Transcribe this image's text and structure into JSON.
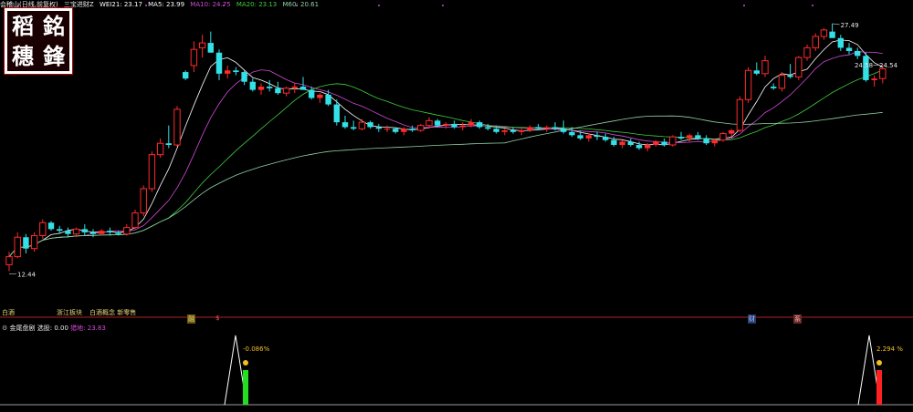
{
  "header": {
    "title": "会稽山(日线,前复权)",
    "indicator_name": "三宝进财Z",
    "wei21": "WEI21: 23.17",
    "ma5": "MA5: 23.99",
    "ma10": "MA10: 24.75",
    "ma20": "MA20: 23.13",
    "m60": "M60: 20.61"
  },
  "colors": {
    "up": "#ff2a2a",
    "down": "#33e0e6",
    "ma5": "#ffffff",
    "ma10": "#d24ad6",
    "ma20": "#3ecf3e",
    "m60": "#8fd2a8",
    "sector": "#e8d27a"
  },
  "seal": {
    "chars": [
      "稻",
      "銘",
      "穗",
      "鋒"
    ]
  },
  "sector_labels": [
    "白酒",
    "浙江板块",
    "白酒概念 新零售"
  ],
  "event_tags": [
    {
      "text": "融",
      "color": "#e8d27a",
      "bg": "#6a5a10"
    },
    {
      "text": "$",
      "color": "#ff5050",
      "bg": "none"
    },
    {
      "text": "财",
      "color": "#a8c8ff",
      "bg": "#2a3a6a"
    },
    {
      "text": "系",
      "color": "#ffb0b0",
      "bg": "#6a2a2a"
    }
  ],
  "indicator_panel": {
    "name": "金尾盘剧",
    "param_label": "选股: 0.00",
    "hunt_label": "猎地: 23.83",
    "signals": [
      {
        "label": "-0.086%",
        "value": -0.086,
        "bar_color": "#22dd22"
      },
      {
        "label": "2.294 %",
        "value": 2.294,
        "bar_color": "#ff2020"
      }
    ]
  },
  "chart_data": {
    "type": "candlestick",
    "title": "会稽山(日线,前复权)",
    "ylim": [
      11.5,
      28.5
    ],
    "annotations": {
      "high": "27.49",
      "low": "12.44",
      "level_a": "24.58",
      "level_b": "24.54"
    },
    "candles": [
      [
        12.6,
        13.4,
        12.2,
        13.1
      ],
      [
        13.1,
        14.6,
        13.0,
        14.3
      ],
      [
        14.3,
        14.5,
        13.3,
        13.6
      ],
      [
        13.6,
        14.6,
        13.4,
        14.4
      ],
      [
        14.4,
        15.4,
        14.2,
        15.2
      ],
      [
        15.2,
        15.3,
        14.7,
        14.8
      ],
      [
        14.8,
        15.0,
        14.5,
        14.7
      ],
      [
        14.7,
        14.9,
        14.3,
        14.5
      ],
      [
        14.5,
        14.9,
        14.3,
        14.8
      ],
      [
        14.8,
        15.1,
        14.4,
        14.6
      ],
      [
        14.6,
        14.8,
        14.3,
        14.5
      ],
      [
        14.5,
        14.8,
        14.4,
        14.7
      ],
      [
        14.7,
        14.9,
        14.4,
        14.6
      ],
      [
        14.6,
        14.7,
        14.4,
        14.5
      ],
      [
        14.5,
        15.1,
        14.4,
        14.9
      ],
      [
        14.9,
        16.0,
        14.8,
        15.8
      ],
      [
        15.8,
        17.5,
        15.6,
        17.3
      ],
      [
        17.3,
        19.6,
        17.1,
        19.4
      ],
      [
        19.4,
        20.4,
        19.2,
        20.1
      ],
      [
        20.1,
        21.2,
        19.8,
        20.0
      ],
      [
        20.0,
        22.4,
        19.9,
        22.2
      ],
      [
        24.5,
        24.6,
        24.0,
        24.1
      ],
      [
        24.9,
        26.4,
        24.5,
        25.9
      ],
      [
        26.0,
        26.8,
        25.4,
        26.3
      ],
      [
        26.3,
        27.0,
        25.7,
        25.7
      ],
      [
        25.7,
        25.9,
        24.0,
        24.4
      ],
      [
        24.4,
        24.9,
        24.1,
        24.6
      ],
      [
        24.6,
        24.8,
        24.3,
        24.5
      ],
      [
        24.5,
        24.6,
        23.7,
        23.9
      ],
      [
        23.9,
        24.1,
        23.3,
        23.4
      ],
      [
        23.4,
        23.8,
        23.1,
        23.6
      ],
      [
        23.6,
        24.0,
        23.3,
        23.5
      ],
      [
        23.5,
        23.9,
        23.1,
        23.2
      ],
      [
        23.2,
        23.6,
        23.0,
        23.5
      ],
      [
        23.5,
        23.8,
        23.2,
        23.6
      ],
      [
        23.6,
        24.2,
        23.4,
        23.4
      ],
      [
        23.4,
        23.6,
        22.8,
        22.9
      ],
      [
        22.9,
        23.2,
        22.6,
        23.1
      ],
      [
        23.1,
        23.4,
        22.4,
        22.5
      ],
      [
        22.5,
        22.8,
        21.2,
        21.4
      ],
      [
        21.4,
        21.8,
        21.0,
        21.1
      ],
      [
        21.1,
        21.5,
        20.9,
        21.0
      ],
      [
        21.0,
        21.6,
        20.9,
        21.4
      ],
      [
        21.4,
        21.5,
        21.0,
        21.1
      ],
      [
        21.1,
        21.3,
        20.8,
        21.0
      ],
      [
        21.0,
        21.2,
        20.8,
        21.0
      ],
      [
        21.0,
        21.1,
        20.7,
        20.8
      ],
      [
        20.8,
        21.1,
        20.6,
        21.0
      ],
      [
        21.0,
        21.2,
        20.8,
        20.9
      ],
      [
        20.9,
        21.3,
        20.8,
        21.2
      ],
      [
        21.2,
        21.7,
        21.0,
        21.5
      ],
      [
        21.5,
        21.6,
        21.1,
        21.2
      ],
      [
        21.2,
        21.4,
        21.0,
        21.3
      ],
      [
        21.3,
        21.5,
        21.0,
        21.1
      ],
      [
        21.1,
        21.4,
        20.9,
        21.2
      ],
      [
        21.2,
        21.6,
        21.1,
        21.4
      ],
      [
        21.4,
        21.5,
        21.0,
        21.1
      ],
      [
        21.1,
        21.3,
        20.9,
        21.0
      ],
      [
        21.0,
        21.2,
        20.7,
        20.8
      ],
      [
        20.8,
        21.0,
        20.6,
        20.9
      ],
      [
        20.9,
        21.1,
        20.7,
        20.8
      ],
      [
        20.8,
        21.0,
        20.6,
        20.9
      ],
      [
        20.9,
        21.2,
        20.8,
        21.1
      ],
      [
        21.1,
        21.3,
        20.9,
        21.0
      ],
      [
        21.0,
        21.2,
        20.8,
        21.1
      ],
      [
        21.1,
        21.4,
        20.9,
        21.0
      ],
      [
        21.0,
        21.5,
        20.7,
        20.8
      ],
      [
        20.8,
        21.1,
        20.5,
        20.6
      ],
      [
        20.6,
        20.9,
        20.3,
        20.4
      ],
      [
        20.4,
        20.7,
        20.2,
        20.6
      ],
      [
        20.6,
        20.8,
        20.3,
        20.5
      ],
      [
        20.5,
        20.7,
        20.2,
        20.3
      ],
      [
        20.3,
        20.5,
        19.9,
        20.0
      ],
      [
        20.0,
        20.3,
        19.8,
        20.2
      ],
      [
        20.2,
        20.4,
        19.9,
        20.0
      ],
      [
        20.0,
        20.2,
        19.7,
        19.8
      ],
      [
        19.8,
        20.1,
        19.6,
        20.0
      ],
      [
        20.0,
        20.3,
        19.9,
        20.2
      ],
      [
        20.2,
        20.4,
        19.9,
        20.0
      ],
      [
        20.0,
        20.6,
        19.9,
        20.5
      ],
      [
        20.5,
        20.8,
        20.3,
        20.4
      ],
      [
        20.4,
        20.7,
        20.2,
        20.6
      ],
      [
        20.6,
        20.8,
        20.3,
        20.4
      ],
      [
        20.4,
        20.6,
        20.0,
        20.1
      ],
      [
        20.1,
        20.4,
        19.9,
        20.3
      ],
      [
        20.3,
        20.8,
        20.2,
        20.7
      ],
      [
        20.7,
        21.0,
        20.5,
        20.9
      ],
      [
        20.9,
        23.0,
        20.8,
        22.8
      ],
      [
        22.8,
        24.8,
        22.6,
        24.6
      ],
      [
        24.6,
        25.1,
        24.3,
        24.4
      ],
      [
        24.4,
        25.5,
        24.2,
        25.2
      ],
      [
        23.6,
        23.8,
        23.4,
        23.5
      ],
      [
        23.5,
        24.5,
        23.3,
        24.3
      ],
      [
        24.3,
        25.0,
        24.1,
        24.2
      ],
      [
        24.2,
        25.5,
        24.0,
        25.4
      ],
      [
        25.4,
        26.2,
        25.2,
        26.0
      ],
      [
        26.0,
        26.9,
        25.8,
        26.7
      ],
      [
        26.7,
        27.2,
        26.5,
        27.1
      ],
      [
        27.0,
        27.49,
        26.9,
        26.6
      ],
      [
        26.6,
        26.8,
        25.8,
        26.0
      ],
      [
        26.0,
        26.3,
        25.6,
        25.8
      ],
      [
        25.8,
        26.0,
        25.3,
        25.5
      ],
      [
        25.5,
        25.7,
        23.9,
        24.0
      ],
      [
        24.0,
        24.3,
        23.6,
        24.1
      ],
      [
        24.1,
        24.9,
        23.8,
        24.7
      ]
    ]
  }
}
